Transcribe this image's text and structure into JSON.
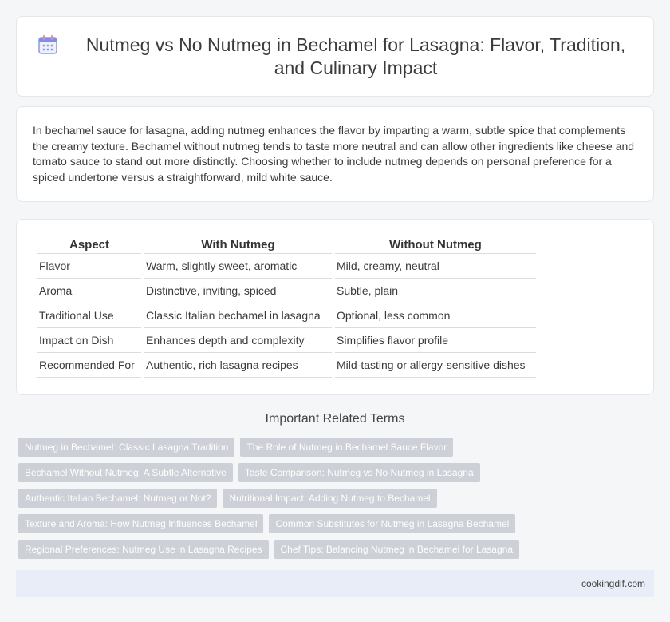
{
  "header": {
    "title": "Nutmeg vs No Nutmeg in Bechamel for Lasagna: Flavor, Tradition, and Culinary Impact",
    "icon": "calendar-icon"
  },
  "intro": {
    "text": "In bechamel sauce for lasagna, adding nutmeg enhances the flavor by imparting a warm, subtle spice that complements the creamy texture. Bechamel without nutmeg tends to taste more neutral and can allow other ingredients like cheese and tomato sauce to stand out more distinctly. Choosing whether to include nutmeg depends on personal preference for a spiced undertone versus a straightforward, mild white sauce."
  },
  "table": {
    "headers": [
      "Aspect",
      "With Nutmeg",
      "Without Nutmeg"
    ],
    "rows": [
      [
        "Flavor",
        "Warm, slightly sweet, aromatic",
        "Mild, creamy, neutral"
      ],
      [
        "Aroma",
        "Distinctive, inviting, spiced",
        "Subtle, plain"
      ],
      [
        "Traditional Use",
        "Classic Italian bechamel in lasagna",
        "Optional, less common"
      ],
      [
        "Impact on Dish",
        "Enhances depth and complexity",
        "Simplifies flavor profile"
      ],
      [
        "Recommended For",
        "Authentic, rich lasagna recipes",
        "Mild-tasting or allergy-sensitive dishes"
      ]
    ]
  },
  "related": {
    "title": "Important Related Terms",
    "tags": [
      [
        "Nutmeg in Bechamel: Classic Lasagna Tradition",
        "The Role of Nutmeg in Bechamel Sauce Flavor"
      ],
      [
        "Bechamel Without Nutmeg: A Subtle Alternative",
        "Taste Comparison: Nutmeg vs No Nutmeg in Lasagna"
      ],
      [
        "Authentic Italian Bechamel: Nutmeg or Not?",
        "Nutritional Impact: Adding Nutmeg to Bechamel"
      ],
      [
        "Texture and Aroma: How Nutmeg Influences Bechamel",
        "Common Substitutes for Nutmeg in Lasagna Bechamel"
      ],
      [
        "Regional Preferences: Nutmeg Use in Lasagna Recipes",
        "Chef Tips: Balancing Nutmeg in Bechamel for Lasagna"
      ]
    ]
  },
  "footer": {
    "site": "cookingdif.com"
  }
}
